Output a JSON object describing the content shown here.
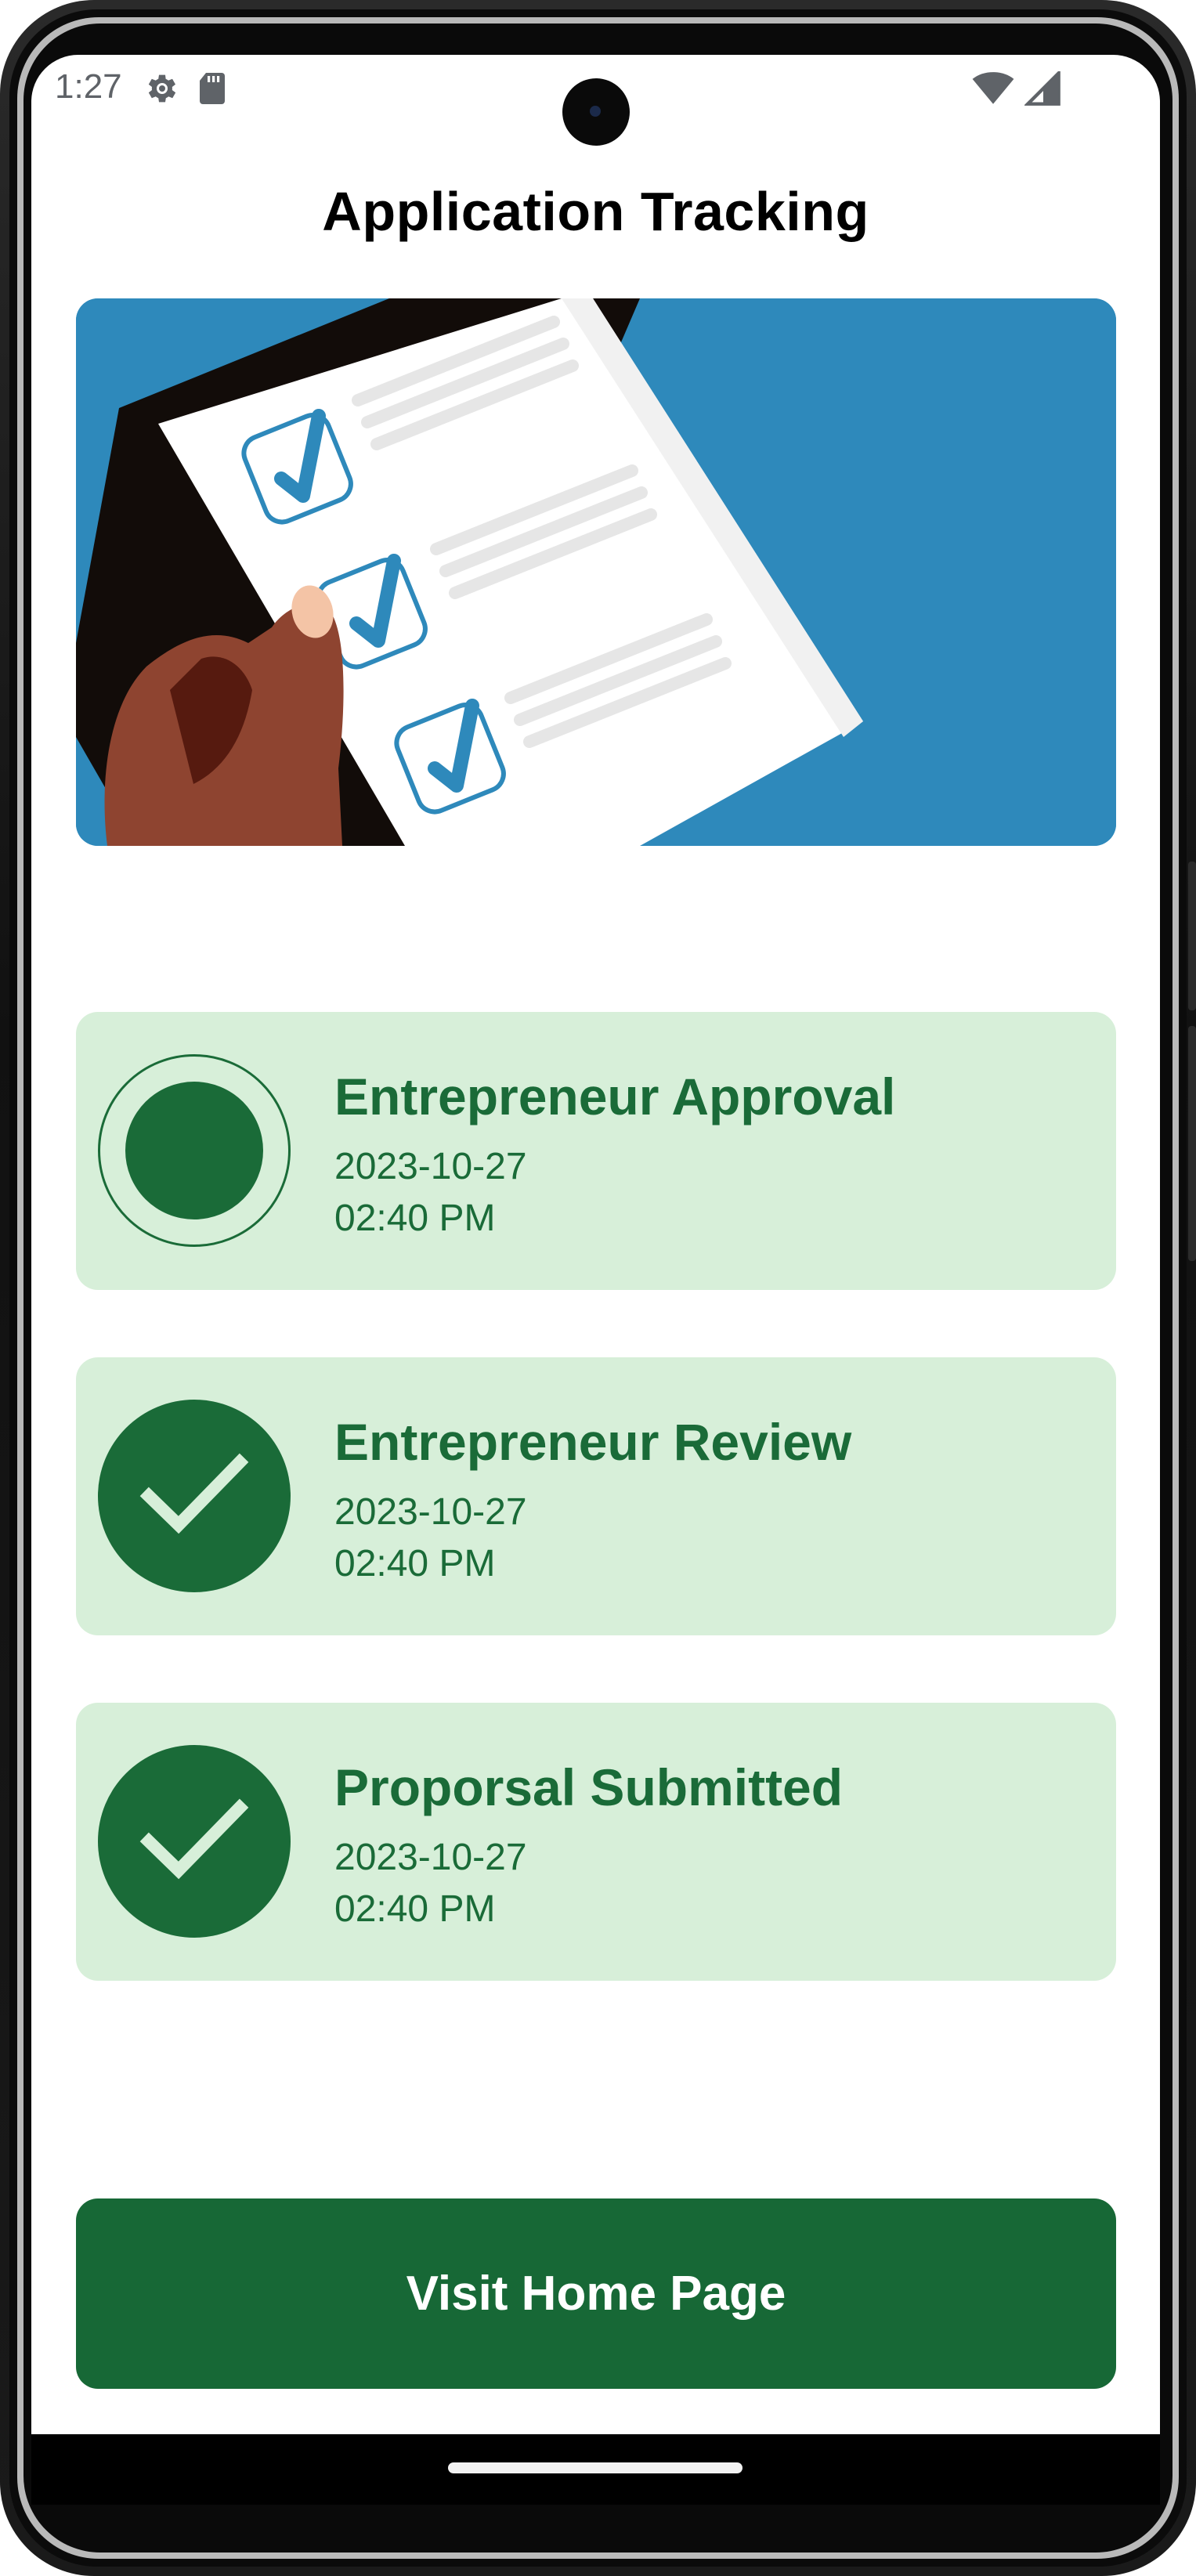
{
  "status_bar": {
    "time": "1:27",
    "icons": [
      "settings-gear-icon",
      "sd-card-icon",
      "wifi-icon",
      "cell-signal-icon"
    ]
  },
  "page": {
    "title": "Application Tracking"
  },
  "hero": {
    "icon": "checklist-illustration",
    "background": "#2e89bb"
  },
  "timeline": [
    {
      "title": "Entrepreneur Approval",
      "date": "2023-10-27",
      "time": "02:40 PM",
      "state": "pending"
    },
    {
      "title": "Entrepreneur Review",
      "date": "2023-10-27",
      "time": "02:40 PM",
      "state": "done"
    },
    {
      "title": "Proporsal Submitted",
      "date": "2023-10-27",
      "time": "02:40 PM",
      "state": "done"
    }
  ],
  "actions": {
    "home_button_label": "Visit Home Page"
  },
  "colors": {
    "accent": "#1a6b38",
    "card_background": "#d7efd9",
    "button_background": "#176836"
  }
}
